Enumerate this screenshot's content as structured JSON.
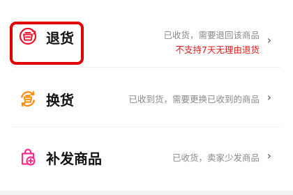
{
  "options": [
    {
      "label": "退货",
      "desc_line1": "已收货，需要退回该商品",
      "desc_line2": "不支持7天无理由退货",
      "icon": "return-box-icon",
      "icon_color": "#e6162d"
    },
    {
      "label": "换货",
      "desc_line1": "已收到货，需要更换已收到的商品",
      "icon": "exchange-box-icon",
      "icon_color": "#ff8a00"
    },
    {
      "label": "补发商品",
      "desc_line1": "已收货，卖家少发商品",
      "icon": "reship-bag-icon",
      "icon_color": "#ff2d8a"
    }
  ],
  "chevron": "›",
  "highlight_color": "#e00000",
  "warning_color": "#e01b1b"
}
